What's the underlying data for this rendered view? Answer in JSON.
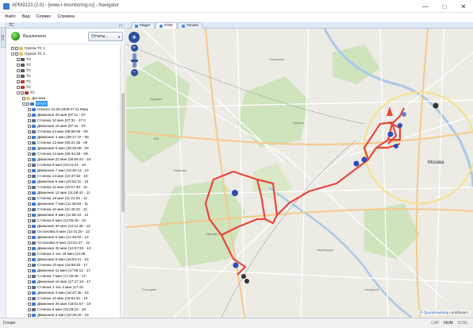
{
  "window": {
    "title": "АРМ3223 (2.0) - [www.r-tmonitoring.ru] - Navigator",
    "minimize": "—",
    "maximize": "□",
    "close": "✕"
  },
  "menu": [
    "Файл",
    "Вид",
    "Сервис",
    "Справка"
  ],
  "side_rail": {
    "tab": "Все"
  },
  "left_panel": {
    "header": "ТС",
    "status_label": "Выключено",
    "report_button": "Отчеты...",
    "tree": [
      {
        "level": 0,
        "toggle": "+",
        "label": "Группа ТС 1",
        "icon": "folder"
      },
      {
        "level": 0,
        "toggle": "-",
        "label": "Группа ТС 2",
        "icon": "folder"
      },
      {
        "level": 1,
        "label": "ТС",
        "icon": "car-dark"
      },
      {
        "level": 1,
        "label": "ТС",
        "icon": "car-dark"
      },
      {
        "level": 1,
        "label": "ТС",
        "icon": "car-dark"
      },
      {
        "level": 1,
        "label": "ТС",
        "icon": "car-dark"
      },
      {
        "level": 1,
        "label": "ТС",
        "icon": "car-red"
      },
      {
        "level": 1,
        "label": "ТС",
        "icon": "car-red"
      },
      {
        "level": 1,
        "toggle": "-",
        "label": "ТС",
        "icon": "car-red"
      },
      {
        "level": 2,
        "label": "Датчики",
        "icon": "folder"
      },
      {
        "level": 2,
        "toggle": "-",
        "label": "Отчет",
        "icon": "report",
        "selected": true
      },
      {
        "level": 3,
        "label": "Начало 22.05.2008 07:11 Маш",
        "icon": "flag"
      },
      {
        "level": 3,
        "label": "Движение 20 мин (07:11 - 07:",
        "icon": "move"
      },
      {
        "level": 3,
        "label": "Стоянка 10 мин (07:31 - 07:4",
        "icon": "stop"
      },
      {
        "level": 3,
        "label": "Движение 15 мин (07:41 - 07:",
        "icon": "move"
      },
      {
        "level": 3,
        "label": "Стоянка 24 мин (08:55:56 - 09:",
        "icon": "stop"
      },
      {
        "level": 3,
        "label": "Движение 4 мин (09:17:47 - 09",
        "icon": "move"
      },
      {
        "level": 3,
        "label": "Стоянка 12 мин (09:21:36 - 09",
        "icon": "stop"
      },
      {
        "level": 3,
        "label": "Движение 6 мин (09:33:05 - 09",
        "icon": "move"
      },
      {
        "level": 3,
        "label": "Стоянка 14 мин (09:44:38 - 09:",
        "icon": "stop"
      },
      {
        "level": 3,
        "label": "Движение 22 мин (09:58:42 - 10:",
        "icon": "move"
      },
      {
        "level": 3,
        "label": "Стоянка 9 мин (10:21:01 - 10:",
        "icon": "stop"
      },
      {
        "level": 3,
        "label": "Движение 7 мин (10:30:14 - 10",
        "icon": "move"
      },
      {
        "level": 3,
        "label": "Стоянка 14 мин (10:37:52 - 10:",
        "icon": "stop"
      },
      {
        "level": 3,
        "label": "Движение 5 мин (10:52:11 - 10",
        "icon": "move"
      },
      {
        "level": 3,
        "label": "Стоянка 11 мин (10:57:30 - 11:",
        "icon": "stop"
      },
      {
        "level": 3,
        "label": "Движение 12 мин (11:08:42 - 11",
        "icon": "move"
      },
      {
        "level": 3,
        "label": "Стоянка 18 мин (11:21:05 - 11:",
        "icon": "stop"
      },
      {
        "level": 3,
        "label": "Движение 7 мин (11:39:40 - 11",
        "icon": "move"
      },
      {
        "level": 3,
        "label": "Стоянка 10 мин (11:46:22 - 11:",
        "icon": "stop"
      },
      {
        "level": 3,
        "label": "Движение 9 мин (11:56:10 - 12",
        "icon": "move"
      },
      {
        "level": 3,
        "label": "Стоянка 6 мин (12:05:48 - 12:",
        "icon": "stop"
      },
      {
        "level": 3,
        "label": "Движение 30 мин (12:11:35 - 12",
        "icon": "move"
      },
      {
        "level": 3,
        "label": "Остановка 5 мин (12:41:20 - 12",
        "icon": "stop"
      },
      {
        "level": 3,
        "label": "Движение 5 мин (12:46:02 - 12",
        "icon": "move"
      },
      {
        "level": 3,
        "label": "Остановка 6 мин (12:51:47 - 12",
        "icon": "stop"
      },
      {
        "level": 3,
        "label": "Движение 38 мин (12:57:33 - 13",
        "icon": "move"
      },
      {
        "level": 3,
        "label": "Стоянка 3 час 19 мин (13:35:",
        "icon": "stop"
      },
      {
        "level": 3,
        "label": "Движение 5 мин (16:54:21 - 16",
        "icon": "move"
      },
      {
        "level": 3,
        "label": "Стоянка 10 мин (16:59:40 - 17",
        "icon": "stop"
      },
      {
        "level": 3,
        "label": "Движение 11 мин (17:09:13 - 17",
        "icon": "move"
      },
      {
        "level": 3,
        "label": "Стоянка 7 мин (17:20:46 - 17:",
        "icon": "stop"
      },
      {
        "level": 3,
        "label": "Движение 16 мин (17:27:18 - 17",
        "icon": "move"
      },
      {
        "level": 3,
        "label": "Стоянка 1 час 4 мин (17:43:",
        "icon": "stop"
      },
      {
        "level": 3,
        "label": "Движение 4 мин (18:47:35 - 18",
        "icon": "move"
      },
      {
        "level": 3,
        "label": "Стоянка 10 мин (18:51:51 - 19",
        "icon": "stop"
      },
      {
        "level": 3,
        "label": "Движение 26 мин (19:01:57 - 19",
        "icon": "move"
      },
      {
        "level": 3,
        "label": "Стоянка 8 мин (19:28:10 - 19:",
        "icon": "stop"
      },
      {
        "level": 3,
        "label": "Движение 3 мин (19:36:20 - 19",
        "icon": "move"
      }
    ]
  },
  "map": {
    "tabs": [
      {
        "label": "Mäger",
        "active": false
      },
      {
        "label": "OSM",
        "active": true
      },
      {
        "label": "Yandex",
        "active": false
      }
    ],
    "zoom_in": "+",
    "zoom_out": "−",
    "pan": "✥",
    "city_label": "Москва",
    "road_label": "М-5",
    "attribution_prefix": "© ",
    "attribution_link": "OpenStreetMap",
    "attribution_suffix": " contributors",
    "colors": {
      "background": "#ecebe4",
      "park": "#cfe3bd",
      "track": "#e8463a",
      "water": "#a9c9ea",
      "marker": "#2a4fb8"
    }
  },
  "status_bar": {
    "ready": "Готово",
    "keys": [
      {
        "label": "CAP",
        "active": false
      },
      {
        "label": "NUM",
        "active": true
      },
      {
        "label": "SCRL",
        "active": false
      }
    ]
  }
}
